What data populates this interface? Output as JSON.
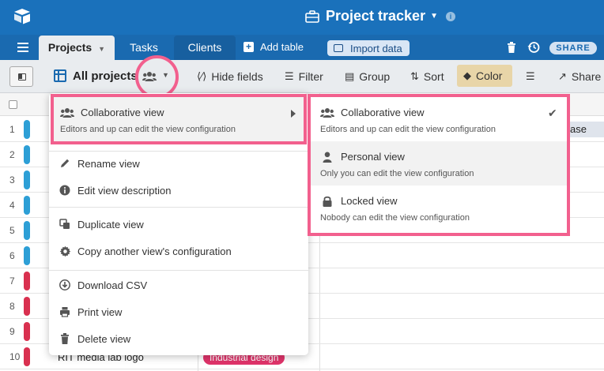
{
  "app": {
    "title": "Project tracker",
    "brand_color": "#1a71bb",
    "highlight_color": "#f2608e"
  },
  "tabs": [
    {
      "label": "Projects",
      "active": true
    },
    {
      "label": "Tasks"
    },
    {
      "label": "Clients"
    }
  ],
  "tabbar": {
    "add_table": "Add table",
    "import_data": "Import data",
    "share": "SHARE"
  },
  "toolbar": {
    "view_name": "All projects",
    "hide_fields": "Hide fields",
    "filter": "Filter",
    "group": "Group",
    "sort": "Sort",
    "color": "Color",
    "share": "Share"
  },
  "grid": {
    "row_numbers": [
      "1",
      "2",
      "3",
      "4",
      "5",
      "6",
      "7",
      "8",
      "9",
      "10"
    ],
    "row_colors": [
      "#2d9fd6",
      "#2d9fd6",
      "#2d9fd6",
      "#2d9fd6",
      "#2d9fd6",
      "#2d9fd6",
      "#d9304f",
      "#d9304f",
      "#d9304f",
      "#d9304f"
    ],
    "last_row_text": "RIT media lab logo",
    "last_row_tag": "Industrial design",
    "clipped_cell": "l case"
  },
  "menu": {
    "collaborative": {
      "title": "Collaborative view",
      "subtitle": "Editors and up can edit the view configuration"
    },
    "items": {
      "rename": "Rename view",
      "edit_description": "Edit view description",
      "duplicate": "Duplicate view",
      "copy_config": "Copy another view's configuration",
      "download_csv": "Download CSV",
      "print": "Print view",
      "delete": "Delete view"
    }
  },
  "submenu": [
    {
      "title": "Collaborative view",
      "subtitle": "Editors and up can edit the view configuration",
      "selected": true,
      "icon": "people-icon"
    },
    {
      "title": "Personal view",
      "subtitle": "Only you can edit the view configuration",
      "selected": false,
      "icon": "person-icon"
    },
    {
      "title": "Locked view",
      "subtitle": "Nobody can edit the view configuration",
      "selected": false,
      "icon": "lock-icon"
    }
  ]
}
